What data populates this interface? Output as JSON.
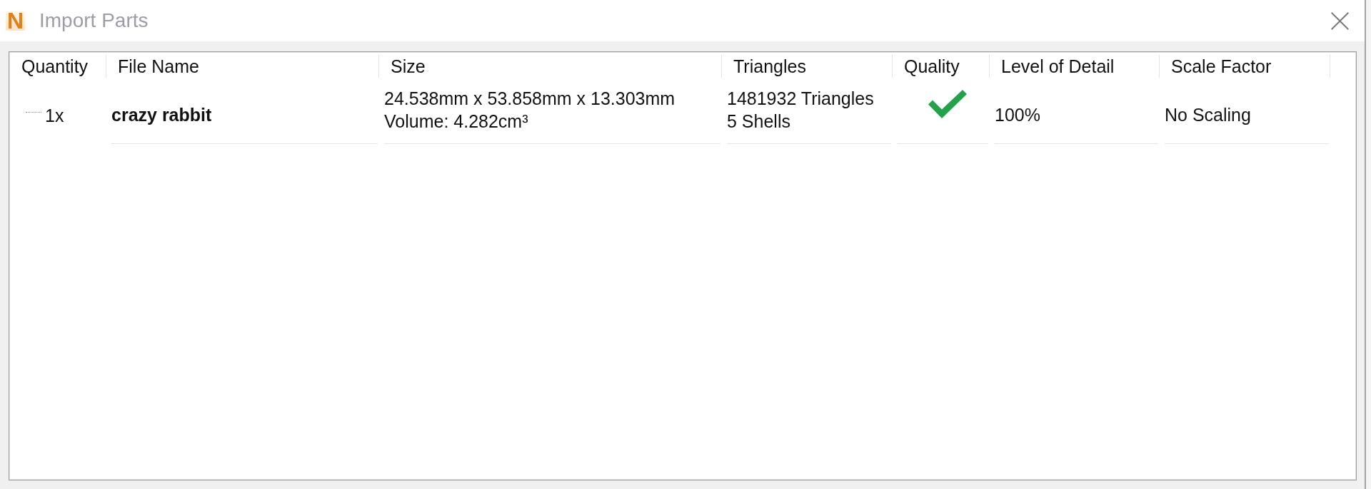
{
  "window": {
    "logo": "N",
    "title": "Import Parts"
  },
  "table": {
    "columns": [
      "Quantity",
      "File Name",
      "Size",
      "Triangles",
      "Quality",
      "Level of Detail",
      "Scale Factor"
    ],
    "rows": [
      {
        "quantity": "1x",
        "file_name": "crazy rabbit",
        "size": [
          "24.538mm x 53.858mm x 13.303mm",
          "Volume: 4.282cm³"
        ],
        "triangles": [
          "1481932 Triangles",
          "5 Shells"
        ],
        "quality_ok": true,
        "level_of_detail": "100%",
        "scale_factor": "No Scaling"
      }
    ]
  }
}
